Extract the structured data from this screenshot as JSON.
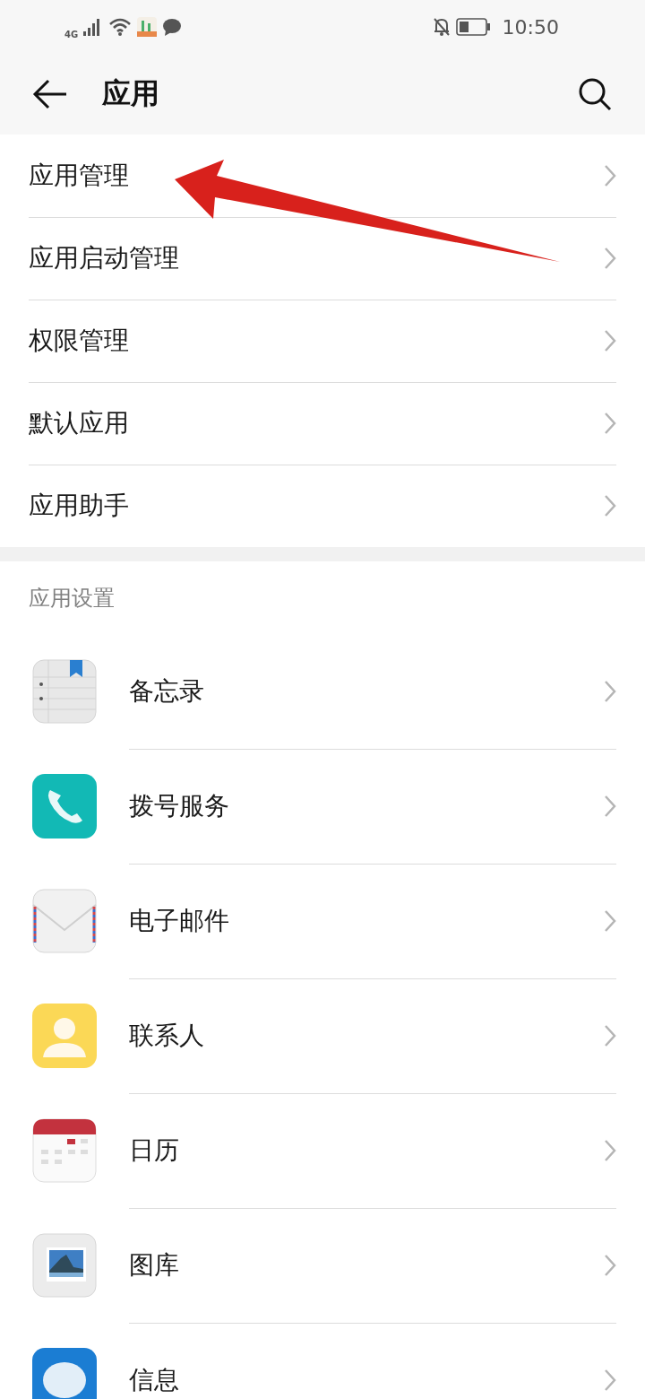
{
  "status_bar": {
    "network": "4G",
    "time": "10:50"
  },
  "header": {
    "title": "应用"
  },
  "menu": [
    {
      "label": "应用管理"
    },
    {
      "label": "应用启动管理"
    },
    {
      "label": "权限管理"
    },
    {
      "label": "默认应用"
    },
    {
      "label": "应用助手"
    }
  ],
  "section": {
    "title": "应用设置"
  },
  "apps": [
    {
      "label": "备忘录",
      "kind": "notes"
    },
    {
      "label": "拨号服务",
      "kind": "phone"
    },
    {
      "label": "电子邮件",
      "kind": "mail"
    },
    {
      "label": "联系人",
      "kind": "contacts"
    },
    {
      "label": "日历",
      "kind": "calendar"
    },
    {
      "label": "图库",
      "kind": "gallery"
    },
    {
      "label": "信息",
      "kind": "messages"
    }
  ]
}
